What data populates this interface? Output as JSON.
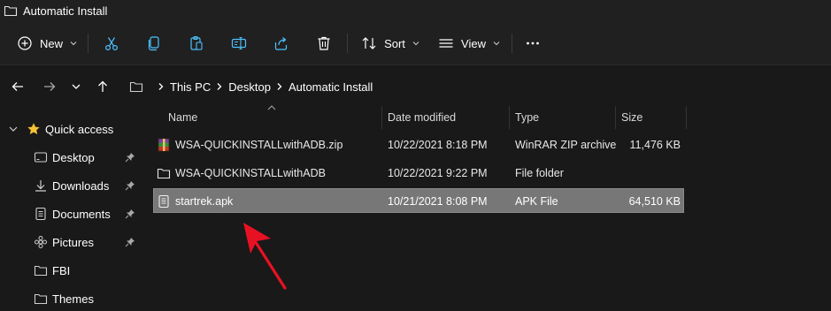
{
  "window": {
    "title": "Automatic Install"
  },
  "toolbar": {
    "new_label": "New",
    "sort_label": "Sort",
    "view_label": "View",
    "items": [
      "plus-circle-icon",
      "cut-icon",
      "copy-icon",
      "paste-icon",
      "rename-icon",
      "share-icon",
      "delete-icon",
      "sort-icon",
      "view-icon",
      "more-icon"
    ]
  },
  "address": {
    "crumbs": [
      "This PC",
      "Desktop",
      "Automatic Install"
    ]
  },
  "sidebar": {
    "items": [
      {
        "label": "Quick access",
        "icon": "star-icon",
        "pinned": false
      },
      {
        "label": "Desktop",
        "icon": "desktop-icon",
        "pinned": true
      },
      {
        "label": "Downloads",
        "icon": "download-icon",
        "pinned": true
      },
      {
        "label": "Documents",
        "icon": "document-icon",
        "pinned": true
      },
      {
        "label": "Pictures",
        "icon": "pictures-icon",
        "pinned": true
      },
      {
        "label": "FBI",
        "icon": "folder-icon",
        "pinned": false
      },
      {
        "label": "Themes",
        "icon": "folder-icon",
        "pinned": false
      }
    ]
  },
  "columns": {
    "name": "Name",
    "date": "Date modified",
    "type": "Type",
    "size": "Size"
  },
  "files": [
    {
      "name": "WSA-QUICKINSTALLwithADB.zip",
      "date": "10/22/2021 8:18 PM",
      "type": "WinRAR ZIP archive",
      "size": "11,476 KB",
      "icon": "winrar-icon",
      "selected": false
    },
    {
      "name": "WSA-QUICKINSTALLwithADB",
      "date": "10/22/2021 9:22 PM",
      "type": "File folder",
      "size": "",
      "icon": "folder-icon",
      "selected": false
    },
    {
      "name": "startrek.apk",
      "date": "10/21/2021 8:08 PM",
      "type": "APK File",
      "size": "64,510 KB",
      "icon": "file-icon",
      "selected": true
    }
  ],
  "colors": {
    "accent": "#e81123",
    "selection": "#777777",
    "star": "#f7c236"
  }
}
